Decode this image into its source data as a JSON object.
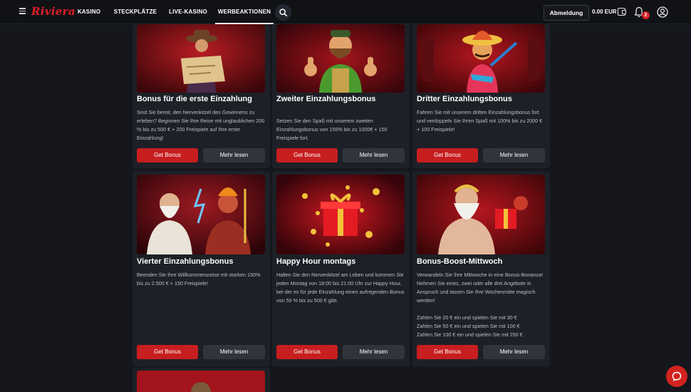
{
  "header": {
    "brand": "Riviera",
    "nav": [
      "KASINO",
      "STECKPLÄTZE",
      "LIVE-KASINO",
      "WERBEAKTIONEN"
    ],
    "active_nav": "WERBEAKTIONEN",
    "logout_label": "Abmeldung",
    "balance": "0.00 EUR",
    "notification_count": "2",
    "icons": [
      "hamburger-icon",
      "search-icon",
      "wallet-icon",
      "bell-icon",
      "user-icon"
    ]
  },
  "promotions": [
    {
      "title": "Bonus für die erste Einzahlung",
      "description": "Sind Sie bereit, den Nervenkitzel des Gewinnens zu erleben? Beginnen Sie Ihre Reise mit unglaublichen 200 % bis zu 500 € + 200 Freispiele auf Ihre erste Einzahlung!",
      "bonus_label": "Get Bonus",
      "more_label": "Mehr lesen"
    },
    {
      "title": "Zweiter Einzahlungsbonus",
      "description": "Setzen Sie den Spaß mit unserem zweiten Einzahlungsbonus von 150% bis zu 1000€ + 150 Freispiele fort.",
      "bonus_label": "Get Bonus",
      "more_label": "Mehr lesen"
    },
    {
      "title": "Dritter Einzahlungsbonus",
      "description": "Fahren Sie mit unserem dritten Einzahlungsbonus fort und verdoppeln Sie Ihren Spaß mit 100% bis zu 2000 € + 100 Freispiele!",
      "bonus_label": "Get Bonus",
      "more_label": "Mehr lesen"
    },
    {
      "title": "Vierter Einzahlungsbonus",
      "description": "Beenden Sie Ihre Willkommensreise mit starken 150% bis zu 2.500 € + 150 Freispiele!",
      "bonus_label": "Get Bonus",
      "more_label": "Mehr lesen"
    },
    {
      "title": "Happy Hour montags",
      "description": "Halten Sie den Nervenkitzel am Leben und kommen Sie jeden Montag von 18:00 bis 21:00 Uhr zur Happy Hour, bei der es für jede Einzahlung einen aufregenden Bonus von 50 % bis zu 500 € gibt.",
      "bonus_label": "Get Bonus",
      "more_label": "Mehr lesen"
    },
    {
      "title": "Bonus-Boost-Mittwoch",
      "description": "Verwandeln Sie Ihre Mittwoche in eine Bonus-Bonanza! Nehmen Sie eines, zwei oder alle drei Angebote in Anspruch und lassen Sie Ihre Wochenmitte magisch werden!",
      "tiers": [
        "Zahlen Sie 20 € ein und spielen Sie mit 30 €",
        "Zahlen Sie 50 € ein und spielen Sie mit 100 €",
        "Zahlen Sie 100 € ein und spielen Sie mit 250 €"
      ],
      "bonus_label": "Get Bonus",
      "more_label": "Mehr lesen"
    }
  ],
  "colors": {
    "background": "#15171d",
    "card": "#1d2027",
    "accent_red": "#c71e1f",
    "secondary_button": "#31343c"
  }
}
